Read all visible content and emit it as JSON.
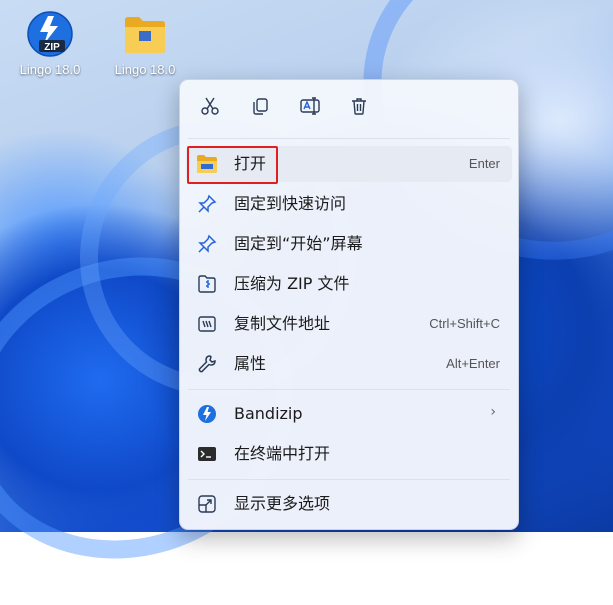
{
  "desktop": {
    "icons": [
      {
        "label": "Lingo 18.0",
        "icon": "bandizip-zip-icon"
      },
      {
        "label": "Lingo 18.0",
        "icon": "folder-icon"
      }
    ]
  },
  "context_menu": {
    "toolbar": [
      {
        "name": "cut",
        "icon": "scissors-icon"
      },
      {
        "name": "copy",
        "icon": "copy-icon"
      },
      {
        "name": "rename",
        "icon": "rename-icon"
      },
      {
        "name": "delete",
        "icon": "trash-icon"
      }
    ],
    "items": [
      {
        "label": "打开",
        "shortcut": "Enter",
        "icon": "folder-open-icon"
      },
      {
        "label": "固定到快速访问",
        "shortcut": "",
        "icon": "pin-icon"
      },
      {
        "label": "固定到“开始”屏幕",
        "shortcut": "",
        "icon": "pin-icon"
      },
      {
        "label": "压缩为 ZIP 文件",
        "shortcut": "",
        "icon": "zip-compress-icon"
      },
      {
        "label": "复制文件地址",
        "shortcut": "Ctrl+Shift+C",
        "icon": "copy-path-icon"
      },
      {
        "label": "属性",
        "shortcut": "Alt+Enter",
        "icon": "wrench-icon"
      },
      {
        "label": "Bandizip",
        "shortcut": "",
        "icon": "bandizip-icon",
        "submenu": true
      },
      {
        "label": "在终端中打开",
        "shortcut": "",
        "icon": "terminal-icon"
      },
      {
        "label": "显示更多选项",
        "shortcut": "",
        "icon": "more-options-icon"
      }
    ]
  },
  "colors": {
    "highlight_border": "#e02020",
    "accent_blue": "#2563d9",
    "folder_yellow": "#f5c542"
  }
}
